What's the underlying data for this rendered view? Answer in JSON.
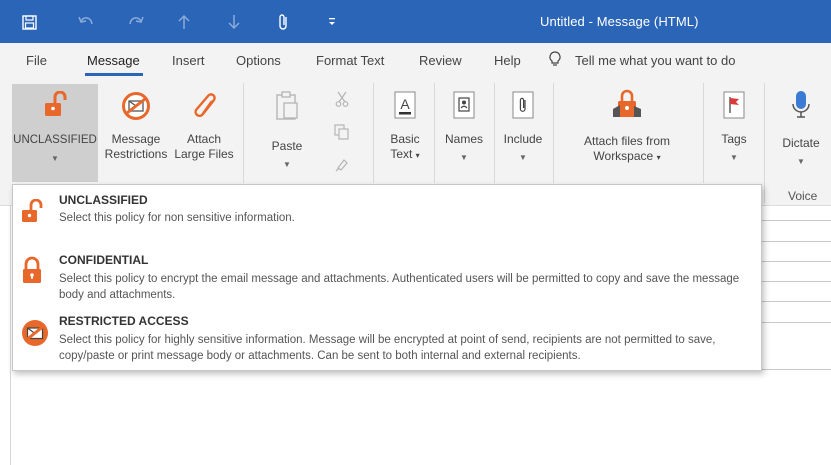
{
  "window": {
    "title": "Untitled  -  Message (HTML)"
  },
  "titlebar_icons": [
    "save-icon",
    "undo-icon",
    "redo-icon",
    "up-arrow-icon",
    "down-arrow-icon",
    "paperclip-icon",
    "quick-access-menu-icon"
  ],
  "menu": {
    "items": [
      "File",
      "Message",
      "Insert",
      "Options",
      "Format Text",
      "Review",
      "Help"
    ],
    "active": "Message",
    "tell_me": "Tell me what you want to do"
  },
  "ribbon": {
    "unclassified": "UNCLASSIFIED",
    "message_restrictions": [
      "Message",
      "Restrictions"
    ],
    "attach_large_files": [
      "Attach",
      "Large Files"
    ],
    "paste": "Paste",
    "basic_text": [
      "Basic",
      "Text"
    ],
    "names": "Names",
    "include": "Include",
    "attach_workspace": [
      "Attach files from",
      "Workspace"
    ],
    "tags": "Tags",
    "dictate": "Dictate",
    "voice_group": "Voice"
  },
  "dropdown": {
    "options": [
      {
        "title": "UNCLASSIFIED",
        "description": "Select this policy for non sensitive information."
      },
      {
        "title": "CONFIDENTIAL",
        "description": "Select this policy to encrypt the email message and attachments. Authenticated users will be permitted to copy and save the message body and attachments."
      },
      {
        "title": "RESTRICTED ACCESS",
        "description": "Select this policy for highly sensitive information. Message will be encrypted at point of send, recipients are not permitted to save, copy/paste or print message body or attachments. Can be sent to both internal and external recipients."
      }
    ]
  },
  "colors": {
    "titlebar": "#2b65b8",
    "accent_orange": "#e8672a",
    "ribbon_bg": "#f3f3f3",
    "selected": "#cfcfcf"
  }
}
